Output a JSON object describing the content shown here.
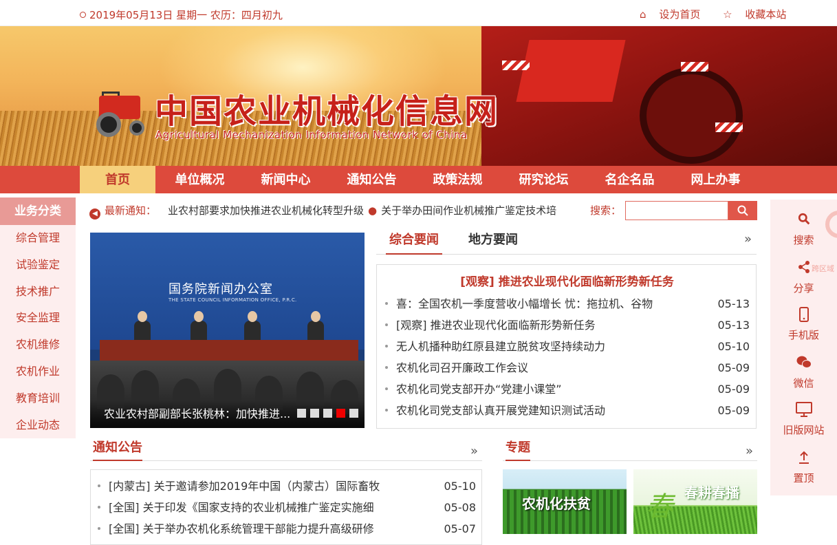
{
  "topbar": {
    "date": "2019年05月13日 星期一 农历：四月初九",
    "set_home": "设为首页",
    "bookmark": "收藏本站"
  },
  "logo": {
    "title": "中国农业机械化信息网",
    "subtitle": "Agricultural Mechanization Information Network of China"
  },
  "nav": {
    "items": [
      "首页",
      "单位概况",
      "新闻中心",
      "通知公告",
      "政策法规",
      "研究论坛",
      "名企名品",
      "网上办事"
    ],
    "active": "首页"
  },
  "sidebar": {
    "title": "业务分类",
    "items": [
      "综合管理",
      "试验鉴定",
      "技术推广",
      "安全监理",
      "农机维修",
      "农机作业",
      "教育培训",
      "企业动态"
    ]
  },
  "notice_bar": {
    "label": "最新通知：",
    "item1": "业农村部要求加快推进农业机械化转型升级",
    "item2": "关于举办田间作业机械推广鉴定技术培"
  },
  "search": {
    "label": "搜索：",
    "placeholder": ""
  },
  "slider": {
    "sign_cn": "国务院新闻办公室",
    "sign_en": "THE STATE COUNCIL INFORMATION OFFICE, P.R.C.",
    "caption": "农业农村部副部长张桃林：加快推进...",
    "active_dot": 4,
    "dot_count": 5
  },
  "news": {
    "tabs": [
      "综合要闻",
      "地方要闻"
    ],
    "headline": "[观察] 推进农业现代化面临新形势新任务",
    "items": [
      {
        "title": "喜：全国农机一季度营收小幅增长 忧：拖拉机、谷物",
        "date": "05-13"
      },
      {
        "title": "[观察] 推进农业现代化面临新形势新任务",
        "date": "05-13"
      },
      {
        "title": "无人机播种助红原县建立脱贫攻坚持续动力",
        "date": "05-10"
      },
      {
        "title": "农机化司召开廉政工作会议",
        "date": "05-09"
      },
      {
        "title": "农机化司党支部开办“党建小课堂”",
        "date": "05-09"
      },
      {
        "title": "农机化司党支部认真开展党建知识测试活动",
        "date": "05-09"
      }
    ]
  },
  "notices": {
    "title": "通知公告",
    "items": [
      {
        "title": "[内蒙古] 关于邀请参加2019年中国（内蒙古）国际畜牧",
        "date": "05-10"
      },
      {
        "title": "[全国] 关于印发《国家支持的农业机械推广鉴定实施细",
        "date": "05-08"
      },
      {
        "title": "[全国] 关于举办农机化系统管理干部能力提升高级研修",
        "date": "05-07"
      }
    ]
  },
  "topics": {
    "title": "专题",
    "items": [
      "农机化扶贫",
      "春耕春播"
    ],
    "chun_char": "春"
  },
  "rightbar": {
    "search": "搜索",
    "share": "分享",
    "mobile": "手机版",
    "wechat": "微信",
    "old_site": "旧版网站",
    "top": "置顶",
    "cross_region": "跨区域"
  },
  "more_symbol": "»",
  "colors": {
    "brand_red": "#c0392b",
    "nav_red": "#dd4a3c",
    "nav_active": "#f6d07c"
  }
}
